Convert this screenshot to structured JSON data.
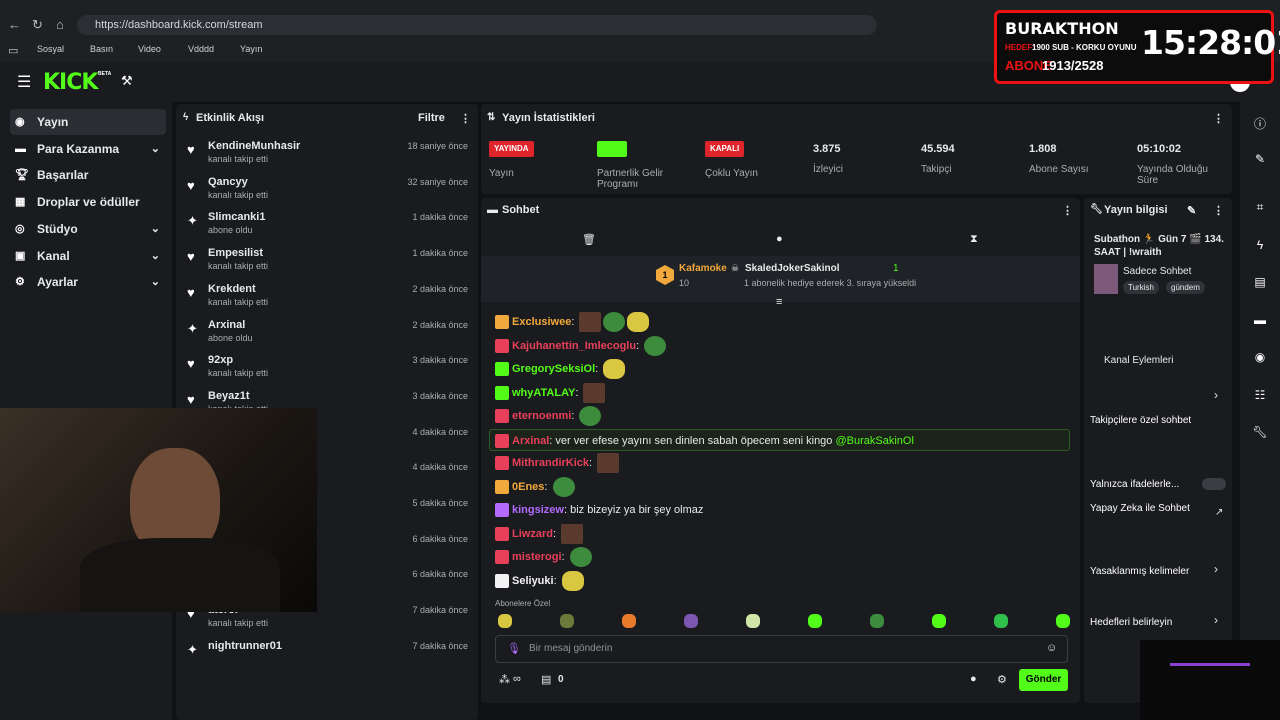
{
  "browser": {
    "url": "https://dashboard.kick.com/stream",
    "bookmarks": [
      "Sosyal",
      "Basın",
      "Video",
      "Vdddd",
      "Yayın"
    ]
  },
  "app": {
    "logo": "KICK",
    "logo_beta": "BETA"
  },
  "sidebar": {
    "items": [
      {
        "label": "Yayın",
        "icon": "broadcast-icon",
        "active": true
      },
      {
        "label": "Para Kazanma",
        "icon": "money-icon"
      },
      {
        "label": "Başarılar",
        "icon": "trophy-icon"
      },
      {
        "label": "Droplar ve ödüller",
        "icon": "gift-icon"
      },
      {
        "label": "Stüdyo",
        "icon": "studio-icon"
      },
      {
        "label": "Kanal",
        "icon": "channel-icon"
      },
      {
        "label": "Ayarlar",
        "icon": "gear-icon"
      }
    ]
  },
  "activity": {
    "title": "Etkinlik Akışı",
    "filter": "Filtre",
    "items": [
      {
        "name": "KendineMunhasir",
        "sub": "kanalı takip etti",
        "time": "18 saniye önce",
        "type": "follow"
      },
      {
        "name": "Qancyy",
        "sub": "kanalı takip etti",
        "time": "32 saniye önce",
        "type": "follow"
      },
      {
        "name": "Slimcanki1",
        "sub": "abone oldu",
        "time": "1 dakika önce",
        "type": "sub"
      },
      {
        "name": "Empesilist",
        "sub": "kanalı takip etti",
        "time": "1 dakika önce",
        "type": "follow"
      },
      {
        "name": "Krekdent",
        "sub": "kanalı takip etti",
        "time": "2 dakika önce",
        "type": "follow"
      },
      {
        "name": "Arxinal",
        "sub": "abone oldu",
        "time": "2 dakika önce",
        "type": "sub"
      },
      {
        "name": "92xp",
        "sub": "kanalı takip etti",
        "time": "3 dakika önce",
        "type": "follow"
      },
      {
        "name": "Beyaz1t",
        "sub": "kanalı takip etti",
        "time": "3 dakika önce",
        "type": "follow"
      },
      {
        "name": "",
        "sub": "",
        "time": "4 dakika önce",
        "type": "follow"
      },
      {
        "name": "",
        "sub": "",
        "time": "4 dakika önce",
        "type": "follow"
      },
      {
        "name": "",
        "sub": "",
        "time": "5 dakika önce",
        "type": "follow"
      },
      {
        "name": "",
        "sub": "",
        "time": "6 dakika önce",
        "type": "follow"
      },
      {
        "name": "",
        "sub": "kanalı takip etti",
        "time": "6 dakika önce",
        "type": "follow"
      },
      {
        "name": "ateror",
        "sub": "kanalı takip etti",
        "time": "7 dakika önce",
        "type": "follow"
      },
      {
        "name": "nightrunner01",
        "sub": "",
        "time": "7 dakika önce",
        "type": "sub"
      }
    ]
  },
  "stats": {
    "title": "Yayın İstatistikleri",
    "items": [
      {
        "badge": "YAYINDA",
        "badge_color": "#e0242b",
        "label": "Yayın"
      },
      {
        "badge": "",
        "badge_color": "#53fc18",
        "label": "Partnerlik Gelir Programı"
      },
      {
        "badge": "KAPALI",
        "badge_color": "#e0242b",
        "label": "Çoklu Yayın"
      },
      {
        "value": "3.875",
        "label": "İzleyici"
      },
      {
        "value": "45.594",
        "label": "Takipçi"
      },
      {
        "value": "1.808",
        "label": "Abone Sayısı"
      },
      {
        "value": "05:10:02",
        "label": "Yayında Olduğu Süre"
      }
    ]
  },
  "chat": {
    "title": "Sohbet",
    "pinned": {
      "rank": "1",
      "user": "Kafamoke",
      "user_count": "10",
      "gifter": "SkaledJokerSakinol",
      "gift_count": "1",
      "gift_text": "1 abonelik hediye ederek 3. sıraya yükseldi"
    },
    "messages": [
      {
        "user": "Exclusiwee",
        "color": "#f2a93b",
        "text": "",
        "emotes": 3
      },
      {
        "user": "Kajuhanettin_Imlecoglu",
        "color": "#e8405a",
        "text": "",
        "emotes": 1
      },
      {
        "user": "GregorySeksiOl",
        "color": "#53fc18",
        "text": "",
        "emotes": 1
      },
      {
        "user": "whyATALAY",
        "color": "#53fc18",
        "text": "",
        "emotes": 1
      },
      {
        "user": "eternoenmi",
        "color": "#e8405a",
        "text": "",
        "emotes": 1
      },
      {
        "user": "Arxinal",
        "color": "#e8405a",
        "text": "ver ver efese yayını sen dinlen sabah öpecem seni kingo",
        "mention": "@BurakSakinOl",
        "emotes": 0,
        "highlight": true
      },
      {
        "user": "MithrandirKick",
        "color": "#e8405a",
        "text": "",
        "emotes": 1
      },
      {
        "user": "0Enes",
        "color": "#f2a93b",
        "text": "",
        "emotes": 1
      },
      {
        "user": "kingsizew",
        "color": "#b36bff",
        "text": "biz bizeyiz ya bir şey olmaz",
        "emotes": 0
      },
      {
        "user": "Liwzard",
        "color": "#e8405a",
        "text": "",
        "emotes": 1
      },
      {
        "user": "misterogi",
        "color": "#e8405a",
        "text": "",
        "emotes": 1
      },
      {
        "user": "Seliyuki",
        "color": "#f2f2f2",
        "text": "",
        "emotes": 1
      }
    ],
    "sub_label": "Abonelere Özel",
    "input_placeholder": "Bir mesaj gönderin",
    "points": "∞",
    "store_count": "0",
    "send": "Gönder"
  },
  "info": {
    "title": "Yayın bilgisi",
    "stream_title": "Subathon 🏃 Gün 7 🎬 134. SAAT | !wraith",
    "category": "Sadece Sohbet",
    "tags": [
      "Turkish",
      "gündem"
    ],
    "actions_title": "Kanal Eylemleri",
    "rows": [
      "Takipçilere özel sohbet",
      "Yalnızca ifadelerle...",
      "Yapay Zeka ile Sohbet",
      "Yasaklanmış kelimeler",
      "Hedefleri belirleyin"
    ]
  },
  "overlay": {
    "title": "BURAKTHON",
    "hedef_label": "HEDEF:",
    "hedef_text": "1900 SUB - KORKU OYUNU",
    "abone_label": "ABONE",
    "abone_value": "1913/2528",
    "timer": "15:28:01"
  }
}
